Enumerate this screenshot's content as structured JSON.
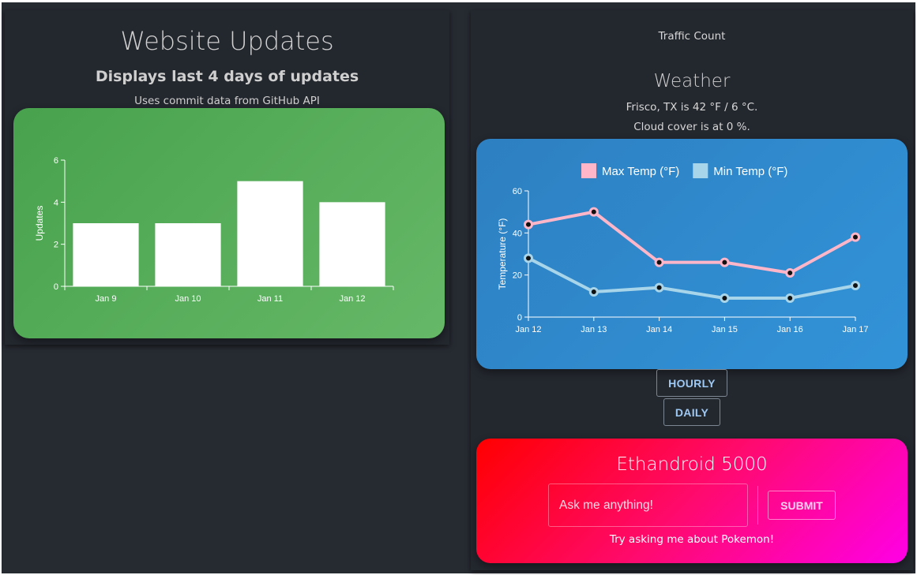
{
  "updates": {
    "title": "Website Updates",
    "subtitle": "Displays last 4 days of updates",
    "note": "Uses commit data from GitHub API"
  },
  "traffic": {
    "title": "Traffic Count"
  },
  "weather": {
    "title": "Weather",
    "line1": "Frisco, TX is 42 °F / 6 °C.",
    "line2": "Cloud cover is at 0 %.",
    "hourly_label": "HOURLY",
    "daily_label": "DAILY"
  },
  "chat": {
    "title": "Ethandroid 5000",
    "input_placeholder": "Ask me anything!",
    "submit_label": "SUBMIT",
    "hint": "Try asking me about Pokemon!"
  },
  "colors": {
    "background": "#262a31",
    "updates_card": "#52a955",
    "weather_card": "#2f88cb",
    "max_temp": "#ffb6c8",
    "min_temp": "#a9d5ea",
    "chat_gradient_start": "#ff0000",
    "chat_gradient_end": "#ff00e6"
  },
  "chart_data": [
    {
      "type": "bar",
      "categories": [
        "Jan 9",
        "Jan 10",
        "Jan 11",
        "Jan 12"
      ],
      "values": [
        3,
        3,
        5,
        4
      ],
      "ylabel": "Updates",
      "ylim": [
        0,
        6
      ],
      "yticks": [
        0,
        2,
        4,
        6
      ],
      "grid": false
    },
    {
      "type": "line",
      "x": [
        "Jan 12",
        "Jan 13",
        "Jan 14",
        "Jan 15",
        "Jan 16",
        "Jan 17"
      ],
      "series": [
        {
          "name": "Max Temp (°F)",
          "values": [
            44,
            50,
            26,
            26,
            21,
            38
          ]
        },
        {
          "name": "Min Temp (°F)",
          "values": [
            28,
            12,
            14,
            9,
            9,
            15
          ]
        }
      ],
      "ylabel": "Temperature (°F)",
      "ylim": [
        0,
        60
      ],
      "yticks": [
        0,
        20,
        40,
        60
      ],
      "legend": "top",
      "grid": false
    }
  ]
}
